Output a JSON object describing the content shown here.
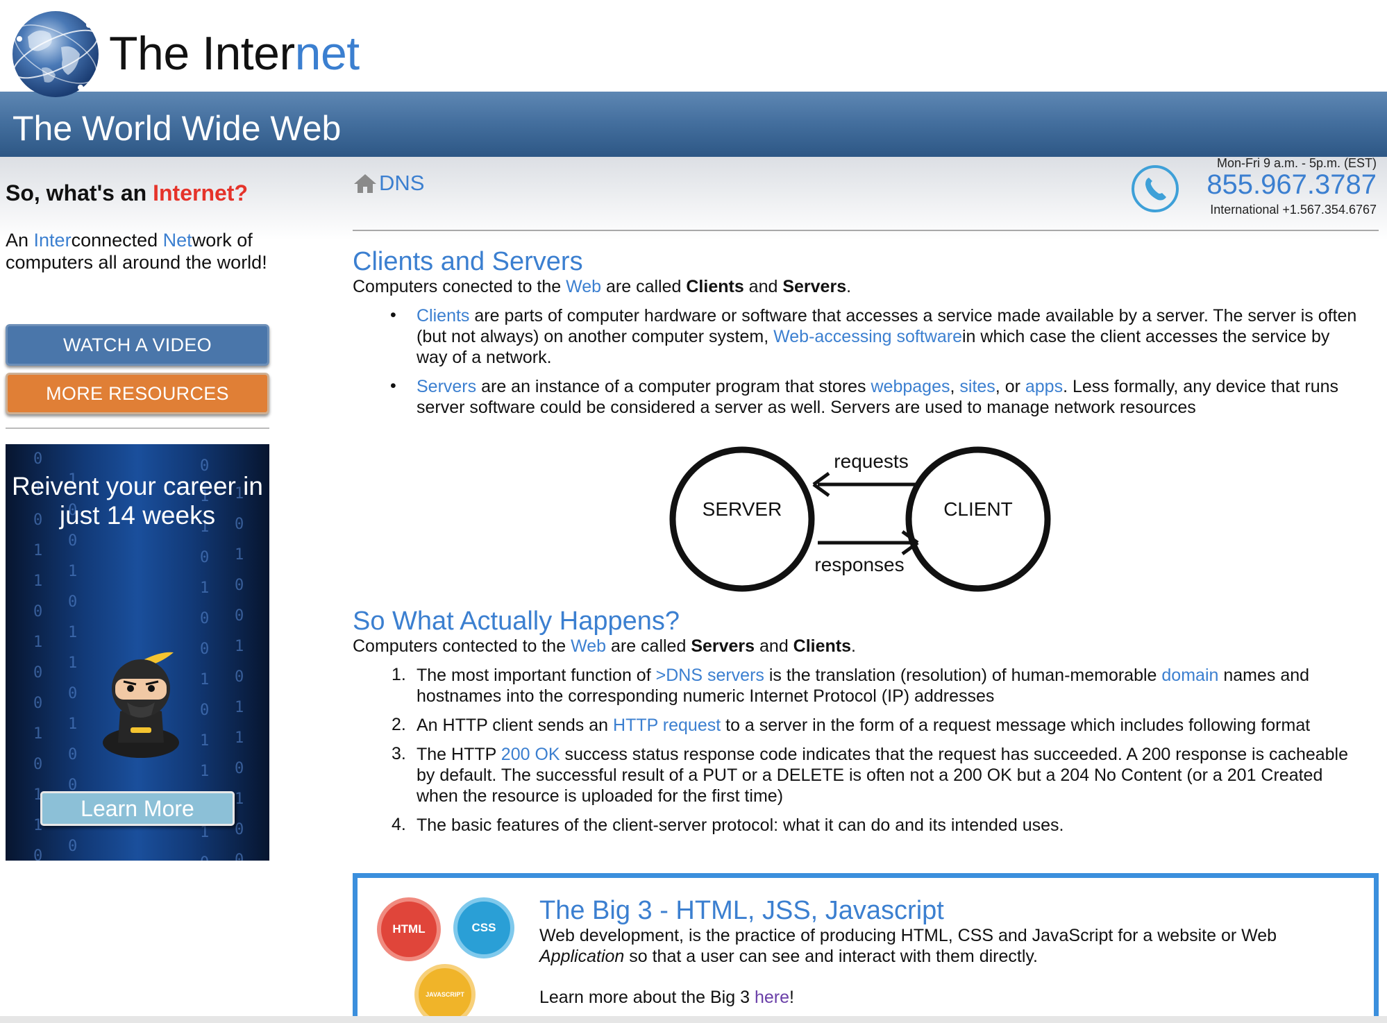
{
  "header": {
    "logo_icon": "globe-icon",
    "title_prefix": "The Inter",
    "title_suffix": "net",
    "banner_title": "The World Wide Web"
  },
  "sidebar": {
    "question_prefix": "So, what's an ",
    "question_highlight": "Internet?",
    "desc": {
      "p1": "An ",
      "l1": "Inter",
      "p2": "connected ",
      "l2": "Net",
      "p3": "work of computers all around the world!"
    },
    "watch_video": "WATCH A VIDEO",
    "more_resources": "MORE RESOURCES",
    "ad": {
      "headline": "Reivent your career in just 14 weeks",
      "button": "Learn More"
    }
  },
  "breadcrumb": {
    "icon": "home-icon",
    "label": "DNS"
  },
  "contact": {
    "hours": "Mon-Fri 9 a.m. - 5p.m. (EST)",
    "phone": "855.967.3787",
    "international": "International +1.567.354.6767",
    "icon": "phone-icon"
  },
  "section1": {
    "title": "Clients and Servers",
    "intro": {
      "p1": "Computers conected to the ",
      "l1": "Web",
      "p2": " are called ",
      "b1": "Clients",
      "p3": " and ",
      "b2": "Servers",
      "p4": "."
    },
    "bullets": [
      {
        "l1": "Clients",
        "t1": " are parts of computer hardware or software that accesses a service made available by a server. The server is often (but not always) on another computer system, ",
        "l2": "Web-accessing software",
        "t2": "in which case the client accesses the service by way of a network."
      },
      {
        "l1": "Servers",
        "t1": " are an instance of a computer program that stores ",
        "l2": "webpages",
        "t2": ", ",
        "l3": "sites",
        "t3": ", or ",
        "l4": "apps",
        "t4": ". Less formally, any device that runs server software could be considered a server as well. Servers are used to manage network resources"
      }
    ]
  },
  "diagram": {
    "server": "SERVER",
    "client": "CLIENT",
    "requests": "requests",
    "responses": "responses"
  },
  "section2": {
    "title": "So What Actually Happens?",
    "intro": {
      "p1": "Computers contected to the ",
      "l1": "Web",
      "p2": " are called ",
      "b1": "Servers",
      "p3": " and ",
      "b2": "Clients",
      "p4": "."
    },
    "items": [
      {
        "n": "1.",
        "t1": "The most important function of ",
        "l1": ">DNS servers",
        "t2": " is the translation (resolution) of human-memorable ",
        "l2": "domain",
        "t3": " names and hostnames into the corresponding numeric Internet Protocol (IP) addresses"
      },
      {
        "n": "2.",
        "t1": "An HTTP client sends an ",
        "l1": "HTTP request",
        "t2": " to a server in the form of a request message which includes following format"
      },
      {
        "n": "3.",
        "t1": "The HTTP ",
        "l1": "200 OK",
        "t2": " success status response code indicates that the request has succeeded. A 200 response is cacheable by default. The successful result of a PUT or a DELETE is often not a 200 OK but a 204 No Content (or a 201 Created when the resource is uploaded for the first time)"
      },
      {
        "n": "4.",
        "t1": "The basic features of the client-server protocol: what it can do and its intended uses."
      }
    ]
  },
  "big3": {
    "title": "The Big 3 - HTML, JSS, Javascript",
    "text_p1": "Web development, is the practice of producing HTML, CSS and JavaScript for a website or Web ",
    "text_em": "Application",
    "text_p2": " so that a user can see and interact with them directly.",
    "more_prefix": "Learn more about the Big 3 ",
    "more_link": "here",
    "more_suffix": "!",
    "badges": {
      "html": "HTML",
      "css": "CSS",
      "js": "JAVASCRIPT"
    }
  },
  "colors": {
    "link": "#3b7fd0",
    "banner": "#45709f",
    "watch_video_button": "#4a76aa",
    "more_resources_button": "#e07f36",
    "highlight_red": "#e5332a"
  }
}
